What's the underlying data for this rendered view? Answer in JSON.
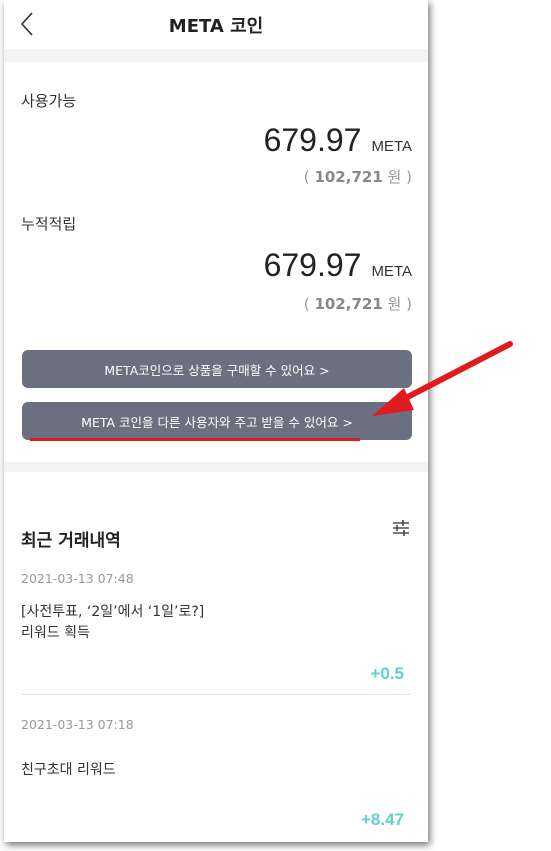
{
  "header": {
    "title": "META 코인",
    "back_icon": "chevron-left-icon"
  },
  "balances": {
    "available": {
      "label": "사용가능",
      "amount": "679.97",
      "unit": "META",
      "krw_open": "(",
      "krw_value": "102,721",
      "krw_unit": "원",
      "krw_close": ")"
    },
    "accumulated": {
      "label": "누적적립",
      "amount": "679.97",
      "unit": "META",
      "krw_open": "(",
      "krw_value": "102,721",
      "krw_unit": "원",
      "krw_close": ")"
    }
  },
  "actions": {
    "shop_label": "META코인으로 상품을 구매할 수 있어요 >",
    "transfer_label": "META 코인을 다른 사용자와 주고 받을 수 있어요 >"
  },
  "history": {
    "title": "최근 거래내역",
    "filter_icon": "sliders-icon",
    "items": [
      {
        "date": "2021-03-13  07:48",
        "line1": "[사전투표, ‘2일’에서 ‘1일’로?]",
        "line2": "리워드 획득",
        "delta": "+0.5"
      },
      {
        "date": "2021-03-13  07:18",
        "line1": "친구초대 리워드",
        "line2": "",
        "delta": "+8.47"
      }
    ]
  },
  "colors": {
    "button_bg": "#6a7080",
    "positive": "#5fd1cf",
    "annotation": "#e11a20"
  }
}
